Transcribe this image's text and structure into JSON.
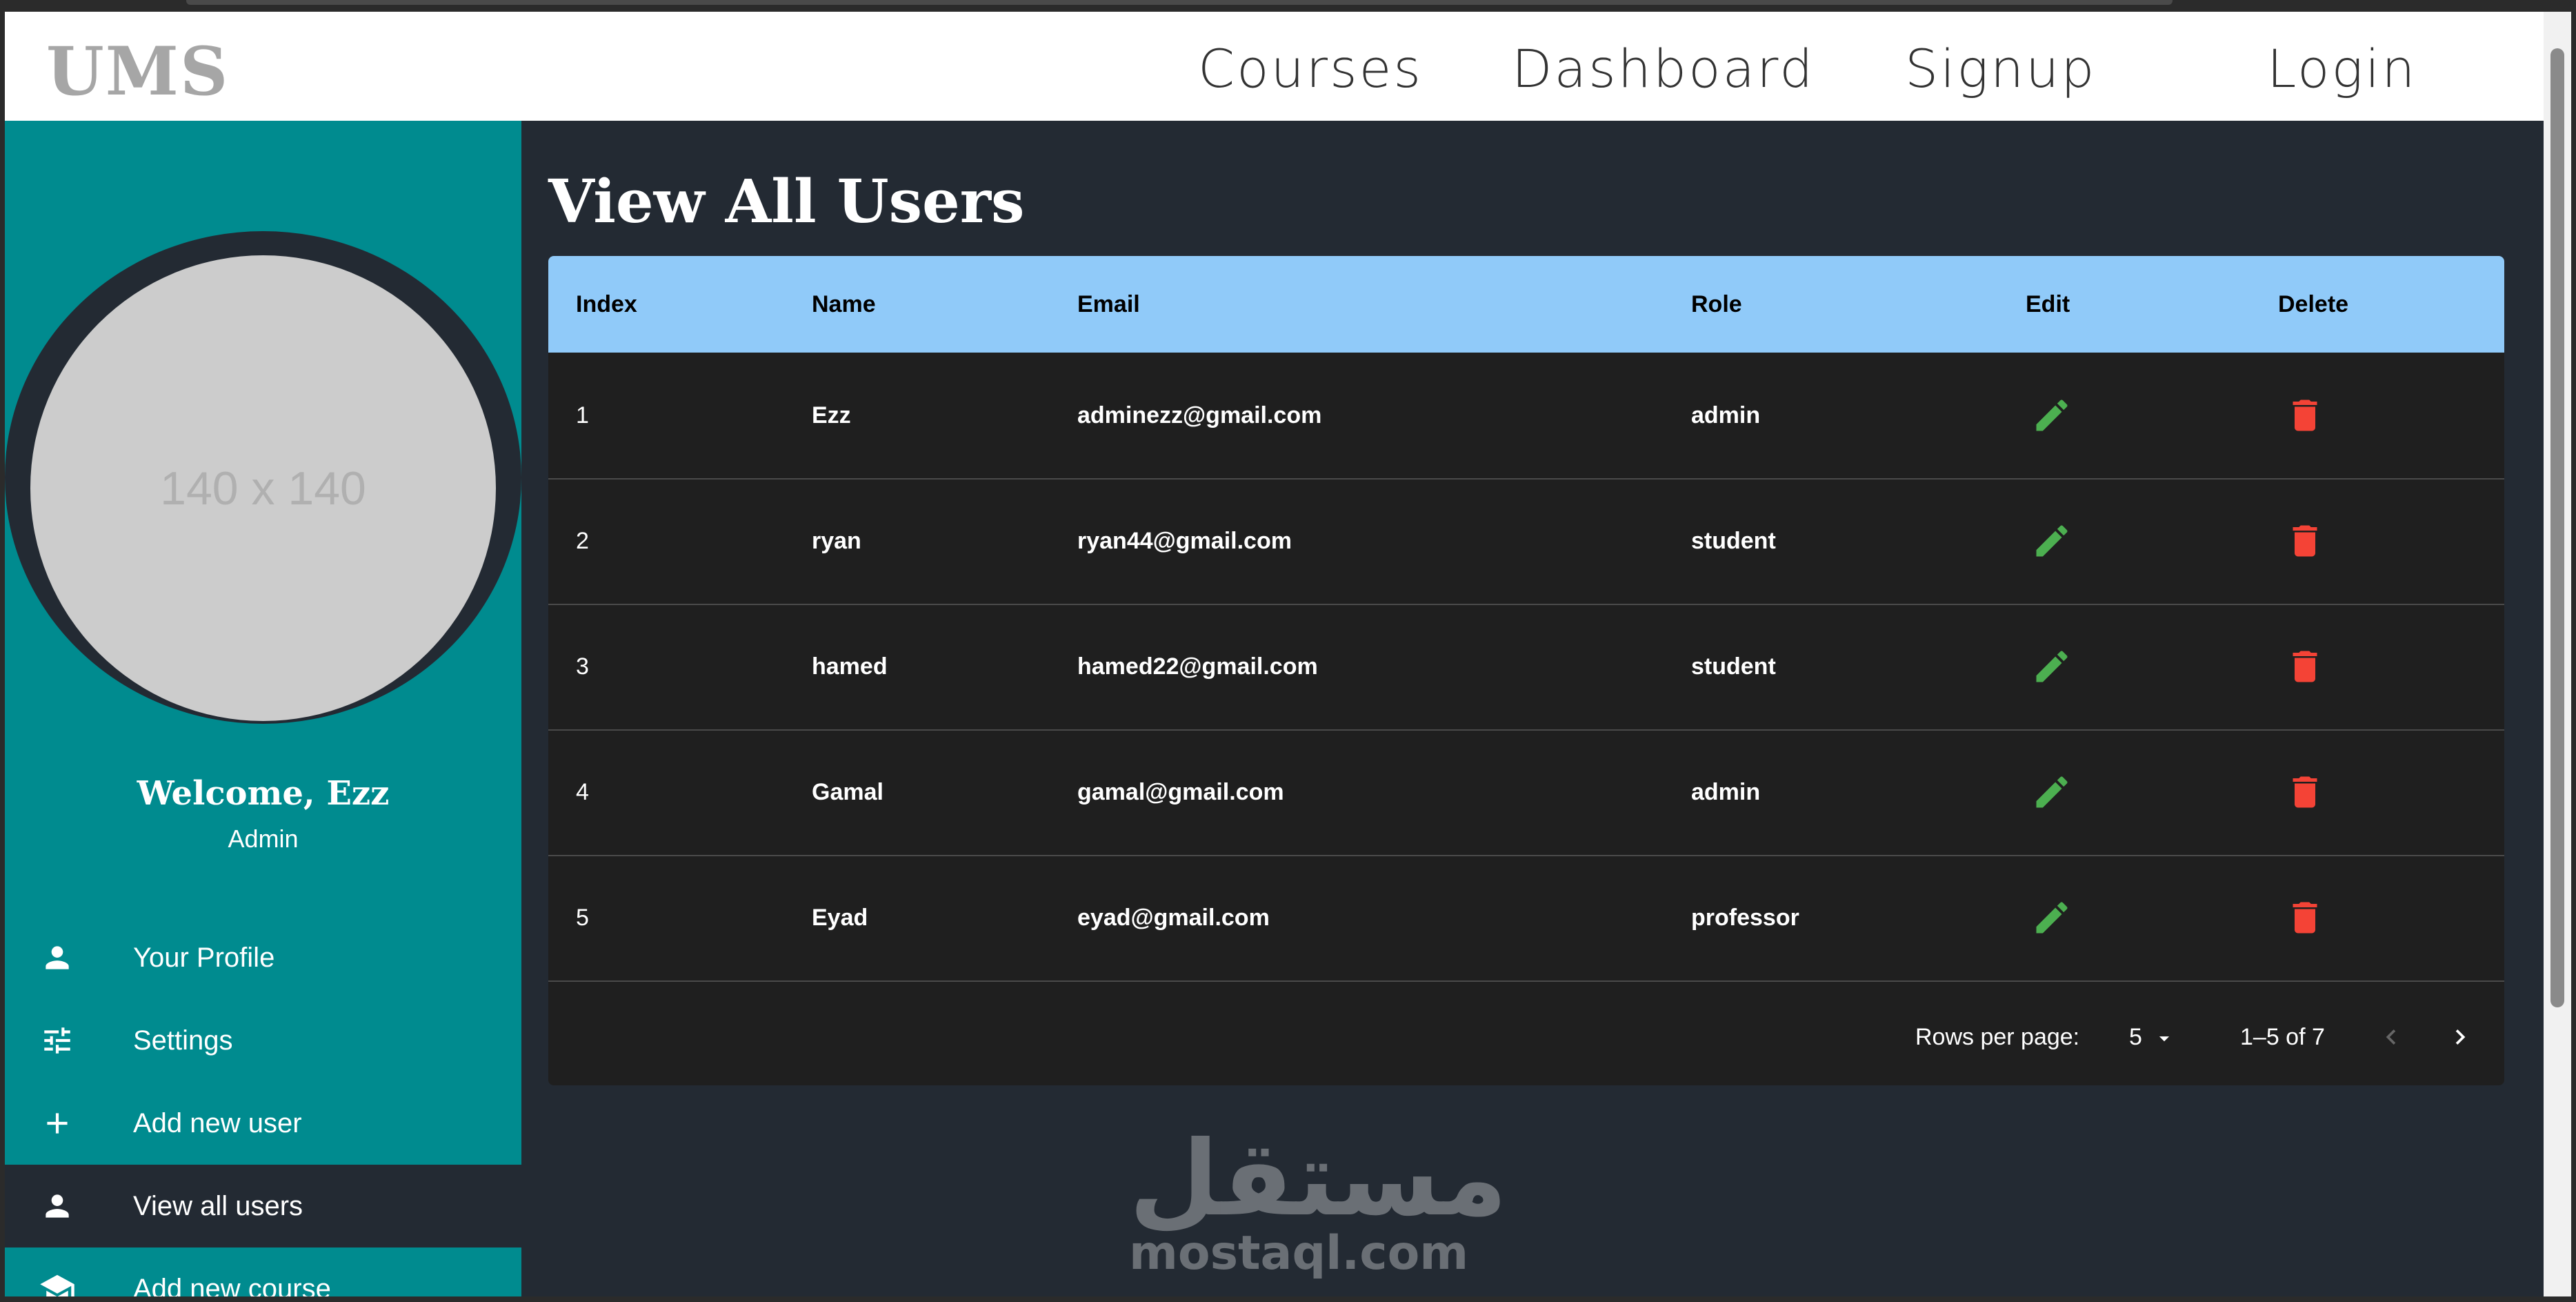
{
  "app": {
    "logo": "UMS"
  },
  "nav": {
    "courses": "Courses",
    "dashboard": "Dashboard",
    "signup": "Signup",
    "login": "Login"
  },
  "sidebar": {
    "avatar_placeholder": "140 x 140",
    "welcome": "Welcome, Ezz",
    "role": "Admin",
    "items": [
      {
        "label": "Your Profile",
        "icon": "person-icon"
      },
      {
        "label": "Settings",
        "icon": "tune-icon"
      },
      {
        "label": "Add new user",
        "icon": "plus-icon"
      },
      {
        "label": "View all users",
        "icon": "person-icon",
        "active": true
      },
      {
        "label": "Add new course",
        "icon": "school-icon"
      }
    ]
  },
  "main": {
    "title": "View All Users",
    "table": {
      "headers": [
        "Index",
        "Name",
        "Email",
        "Role",
        "Edit",
        "Delete"
      ],
      "rows": [
        {
          "index": "1",
          "name": "Ezz",
          "email": "adminezz@gmail.com",
          "role": "admin"
        },
        {
          "index": "2",
          "name": "ryan",
          "email": "ryan44@gmail.com",
          "role": "student"
        },
        {
          "index": "3",
          "name": "hamed",
          "email": "hamed22@gmail.com",
          "role": "student"
        },
        {
          "index": "4",
          "name": "Gamal",
          "email": "gamal@gmail.com",
          "role": "admin"
        },
        {
          "index": "5",
          "name": "Eyad",
          "email": "eyad@gmail.com",
          "role": "professor"
        }
      ],
      "pagination": {
        "rows_per_page_label": "Rows per page:",
        "rows_per_page_value": "5",
        "range": "1–5 of 7"
      }
    }
  },
  "watermark": {
    "arabic": "مستقل",
    "text": "mostaql.com"
  },
  "colors": {
    "header_bg": "#ffffff",
    "sidebar_bg": "#008b8f",
    "page_bg": "#232a33",
    "table_head_bg": "#90caf9",
    "table_bg": "#1f1f1f",
    "edit_icon": "#4caf50",
    "delete_icon": "#f44336"
  }
}
